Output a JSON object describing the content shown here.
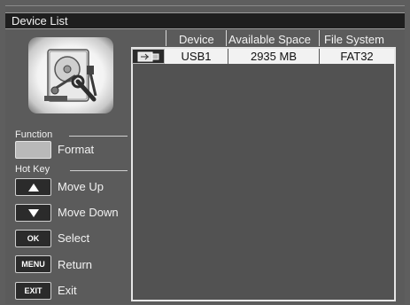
{
  "window": {
    "title": "Device List"
  },
  "table": {
    "columns": [
      "Device",
      "Available Space",
      "File System"
    ],
    "rows": [
      {
        "icon": "usb-drive-icon",
        "device": "USB1",
        "space": "2935 MB",
        "fs": "FAT32"
      }
    ]
  },
  "function_section": {
    "label": "Function",
    "format_label": "Format"
  },
  "hotkey_section": {
    "label": "Hot Key",
    "keys": [
      {
        "key": "",
        "icon": "arrow-up-icon",
        "action": "Move Up"
      },
      {
        "key": "",
        "icon": "arrow-down-icon",
        "action": "Move Down"
      },
      {
        "key": "OK",
        "action": "Select"
      },
      {
        "key": "MENU",
        "action": "Return"
      },
      {
        "key": "EXIT",
        "action": "Exit"
      }
    ]
  },
  "illustration": {
    "icon": "hard-disk-tools-icon"
  },
  "colors": {
    "selected_row": "#f2f2f2",
    "background": "#5b5b5b",
    "titlebar": "#1e1e1e"
  }
}
